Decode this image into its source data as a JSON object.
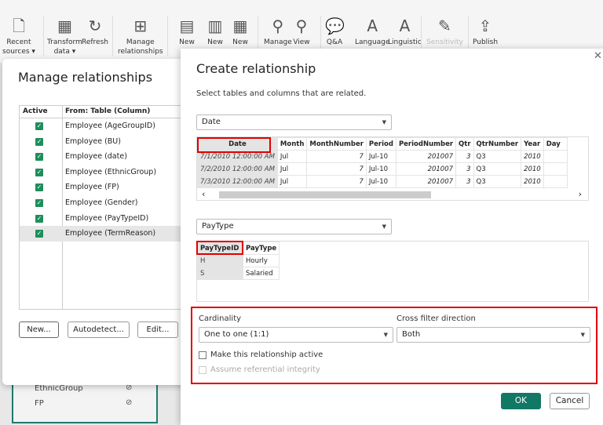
{
  "ribbon": {
    "items": [
      {
        "label": "Recent\nsources ▾",
        "icon": "recent-sources-icon"
      },
      {
        "label": "Transform\ndata ▾",
        "icon": "transform-data-icon"
      },
      {
        "label": "Refresh",
        "icon": "refresh-icon"
      },
      {
        "label": "Manage\nrelationships",
        "icon": "manage-relationships-icon"
      },
      {
        "label": "New\nm",
        "icon": "new-measure-icon"
      },
      {
        "label": "New",
        "icon": "new-column-icon"
      },
      {
        "label": "New",
        "icon": "new-table-icon"
      },
      {
        "label": "Manage",
        "icon": "manage-roles-icon"
      },
      {
        "label": "View",
        "icon": "view-as-icon"
      },
      {
        "label": "Q&A",
        "icon": "qa-icon"
      },
      {
        "label": "Language",
        "icon": "language-icon"
      },
      {
        "label": "Linguistic",
        "icon": "linguistic-icon"
      },
      {
        "label": "Sensitivity",
        "icon": "sensitivity-icon"
      },
      {
        "label": "Publish",
        "icon": "publish-icon"
      }
    ]
  },
  "fields": [
    "EthnicGroup",
    "FP"
  ],
  "manage": {
    "title": "Manage relationships",
    "col_active": "Active",
    "col_from": "From: Table (Column)",
    "rows": [
      "Employee (AgeGroupID)",
      "Employee (BU)",
      "Employee (date)",
      "Employee (EthnicGroup)",
      "Employee (FP)",
      "Employee (Gender)",
      "Employee (PayTypeID)",
      "Employee (TermReason)"
    ],
    "new": "New...",
    "autodetect": "Autodetect...",
    "edit": "Edit..."
  },
  "create": {
    "title": "Create relationship",
    "subtitle": "Select tables and columns that are related.",
    "table1": "Date",
    "t1cols": [
      "Date",
      "Month",
      "MonthNumber",
      "Period",
      "PeriodNumber",
      "Qtr",
      "QtrNumber",
      "Year",
      "Day"
    ],
    "t1rows": [
      [
        "7/1/2010 12:00:00 AM",
        "Jul",
        "7",
        "Jul-10",
        "201007",
        "3",
        "Q3",
        "2010",
        ""
      ],
      [
        "7/2/2010 12:00:00 AM",
        "Jul",
        "7",
        "Jul-10",
        "201007",
        "3",
        "Q3",
        "2010",
        ""
      ],
      [
        "7/3/2010 12:00:00 AM",
        "Jul",
        "7",
        "Jul-10",
        "201007",
        "3",
        "Q3",
        "2010",
        ""
      ]
    ],
    "table2": "PayType",
    "t2cols": [
      "PayTypeID",
      "PayType"
    ],
    "t2rows": [
      [
        "H",
        "Hourly"
      ],
      [
        "S",
        "Salaried"
      ]
    ],
    "cardinality_label": "Cardinality",
    "cardinality": "One to one (1:1)",
    "crossfilter_label": "Cross filter direction",
    "crossfilter": "Both",
    "active_label": "Make this relationship active",
    "active": false,
    "integrity_label": "Assume referential integrity",
    "integrity": false,
    "ok": "OK",
    "cancel": "Cancel"
  },
  "colors": {
    "accent": "#117865",
    "highlight": "#e00000"
  }
}
